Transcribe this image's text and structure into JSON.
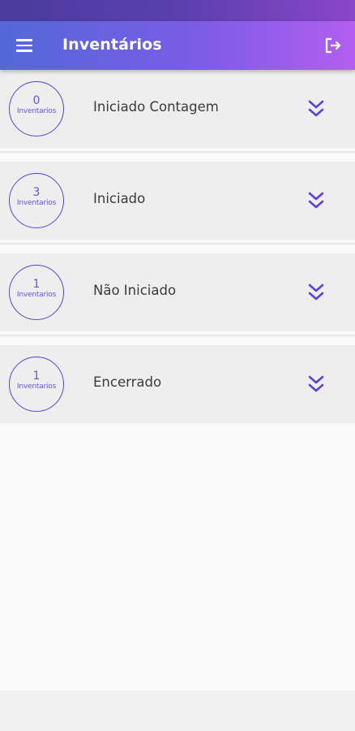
{
  "app_bar": {
    "title": "Inventários",
    "gradient_start": "#5268d8",
    "gradient_end": "#b35ef0",
    "menu_icon": "menu-icon",
    "logout_icon": "logout-icon"
  },
  "accent_color": "#5e3fd8",
  "cards": [
    {
      "count": "0",
      "count_label": "Inventarios",
      "label": "Iniciado Contagem",
      "expand_icon": "double-chevron-down-icon"
    },
    {
      "count": "3",
      "count_label": "Inventarios",
      "label": "Iniciado",
      "expand_icon": "double-chevron-down-icon"
    },
    {
      "count": "1",
      "count_label": "Inventarios",
      "label": "Não Iniciado",
      "expand_icon": "double-chevron-down-icon"
    },
    {
      "count": "1",
      "count_label": "Inventarios",
      "label": "Encerrado",
      "expand_icon": "double-chevron-down-icon"
    }
  ]
}
